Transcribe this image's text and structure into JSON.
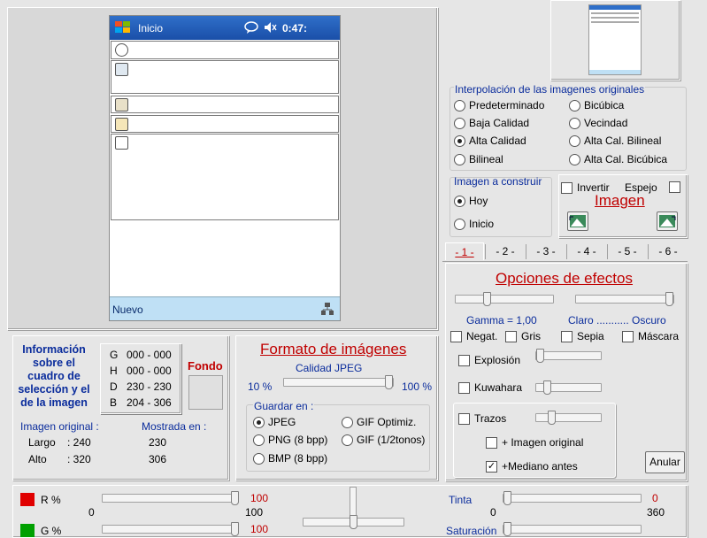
{
  "pda": {
    "title": "Inicio",
    "time": "0:47:",
    "bottom_label": "Nuevo"
  },
  "interpolation": {
    "title": "Interpolación de las imagenes originales",
    "options": [
      "Predeterminado",
      "Bicúbica",
      "Baja Calidad",
      "Vecindad",
      "Alta Calidad",
      "Alta Cal. Bilineal",
      "Bilineal",
      "Alta Cal. Bicúbica"
    ],
    "selected": "Alta Calidad"
  },
  "build": {
    "title": "Imagen a construir",
    "hoy": "Hoy",
    "inicio": "Inicio",
    "selected": "Hoy"
  },
  "image_box": {
    "invertir": "Invertir",
    "espejo": "Espejo",
    "title": "Imagen"
  },
  "tabs": [
    "- 1 -",
    "- 2 -",
    "- 3 -",
    "- 4 -",
    "- 5 -",
    "- 6 -"
  ],
  "effects": {
    "title": "Opciones de efectos",
    "gamma": "Gamma = 1,00",
    "claro": "Claro ........... Oscuro",
    "negat": "Negat.",
    "gris": "Gris",
    "sepia": "Sepia",
    "mascara": "Máscara",
    "explosion": "Explosión",
    "kuwahara": "Kuwahara",
    "trazos": "Trazos",
    "imagen_original": "+ Imagen original",
    "mediano": "+Mediano antes",
    "mediano_checked": true,
    "anular": "Anular"
  },
  "info": {
    "title": "Información sobre el cuadro de selección y el de la imagen",
    "coords": [
      {
        "k": "G",
        "v": "000 - 000"
      },
      {
        "k": "H",
        "v": "000 - 000"
      },
      {
        "k": "D",
        "v": "230 - 230"
      },
      {
        "k": "B",
        "v": "204 - 306"
      }
    ],
    "fondo": "Fondo",
    "imagen_original": "Imagen original :",
    "mostrada": "Mostrada en :",
    "largo_label": "Largo",
    "largo_val": ": 240",
    "largo_shown": "230",
    "alto_label": "Alto",
    "alto_val": ": 320",
    "alto_shown": "306"
  },
  "format": {
    "title": "Formato de imágenes",
    "calidad": "Calidad JPEG",
    "min": "10 %",
    "max": "100 %",
    "quality_level": 1.0,
    "guardar": "Guardar en :",
    "options": [
      "JPEG",
      "GIF Optimiz.",
      "PNG (8 bpp)",
      "GIF (1/2tonos)",
      "BMP (8 bpp)"
    ],
    "selected": "JPEG"
  },
  "color": {
    "r_label": "R %",
    "r_value": "100",
    "r_min": "0",
    "r_max": "100",
    "g_label": "G %",
    "g_value": "100",
    "tinta_label": "Tinta",
    "tinta_value": "0",
    "tinta_min": "0",
    "tinta_max": "360",
    "saturacion_label": "Saturación",
    "red": "#e00000",
    "green": "#00a000"
  }
}
